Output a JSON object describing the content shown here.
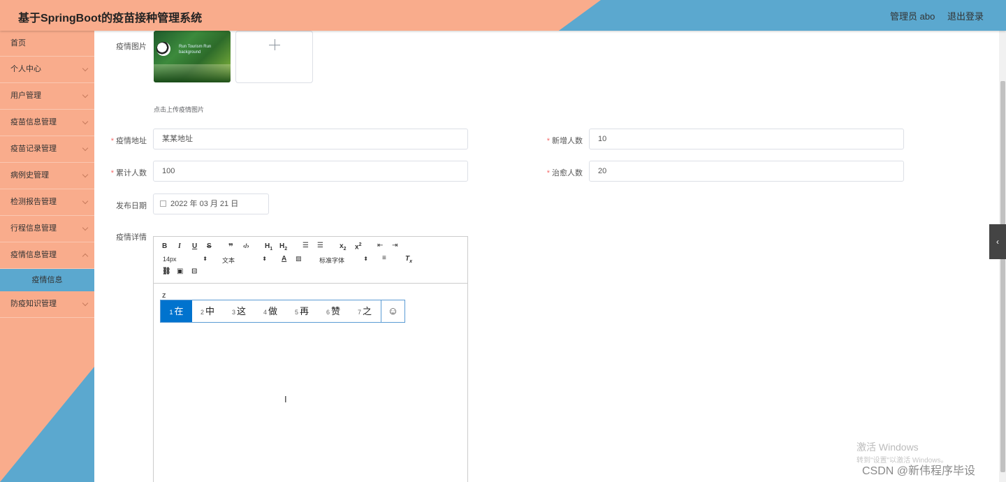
{
  "header": {
    "title": "基于SpringBoot的疫苗接种管理系统",
    "user_label": "管理员 abo",
    "logout_label": "退出登录"
  },
  "sidebar": {
    "items": [
      {
        "label": "首页"
      },
      {
        "label": "个人中心"
      },
      {
        "label": "用户管理"
      },
      {
        "label": "疫苗信息管理"
      },
      {
        "label": "疫苗记录管理"
      },
      {
        "label": "病例史管理"
      },
      {
        "label": "检测报告管理"
      },
      {
        "label": "行程信息管理"
      },
      {
        "label": "疫情信息管理"
      }
    ],
    "active_sub": "疫情信息",
    "last_item": "防疫知识管理"
  },
  "form": {
    "image_label": "疫情图片",
    "upload_tip": "点击上传疫情图片",
    "thumb_text1": "Run Tourism Run",
    "thumb_text2": "background",
    "address_label": "疫情地址",
    "address_value": "某某地址",
    "new_label": "新增人数",
    "new_value": "10",
    "total_label": "累计人数",
    "total_value": "100",
    "cured_label": "治愈人数",
    "cured_value": "20",
    "date_label": "发布日期",
    "date_value": "2022 年 03 月 21 日",
    "detail_label": "疫情详情"
  },
  "editor": {
    "font_size": "14px",
    "paragraph": "文本",
    "font_family": "标准字体",
    "typed": "z"
  },
  "ime": {
    "candidates": [
      {
        "n": "1",
        "c": "在"
      },
      {
        "n": "2",
        "c": "中"
      },
      {
        "n": "3",
        "c": "这"
      },
      {
        "n": "4",
        "c": "做"
      },
      {
        "n": "5",
        "c": "再"
      },
      {
        "n": "6",
        "c": "赞"
      },
      {
        "n": "7",
        "c": "之"
      }
    ]
  },
  "watermark": {
    "line1": "激活 Windows",
    "line2": "转到\"设置\"以激活 Windows。",
    "csdn": "CSDN @新伟程序毕设"
  }
}
